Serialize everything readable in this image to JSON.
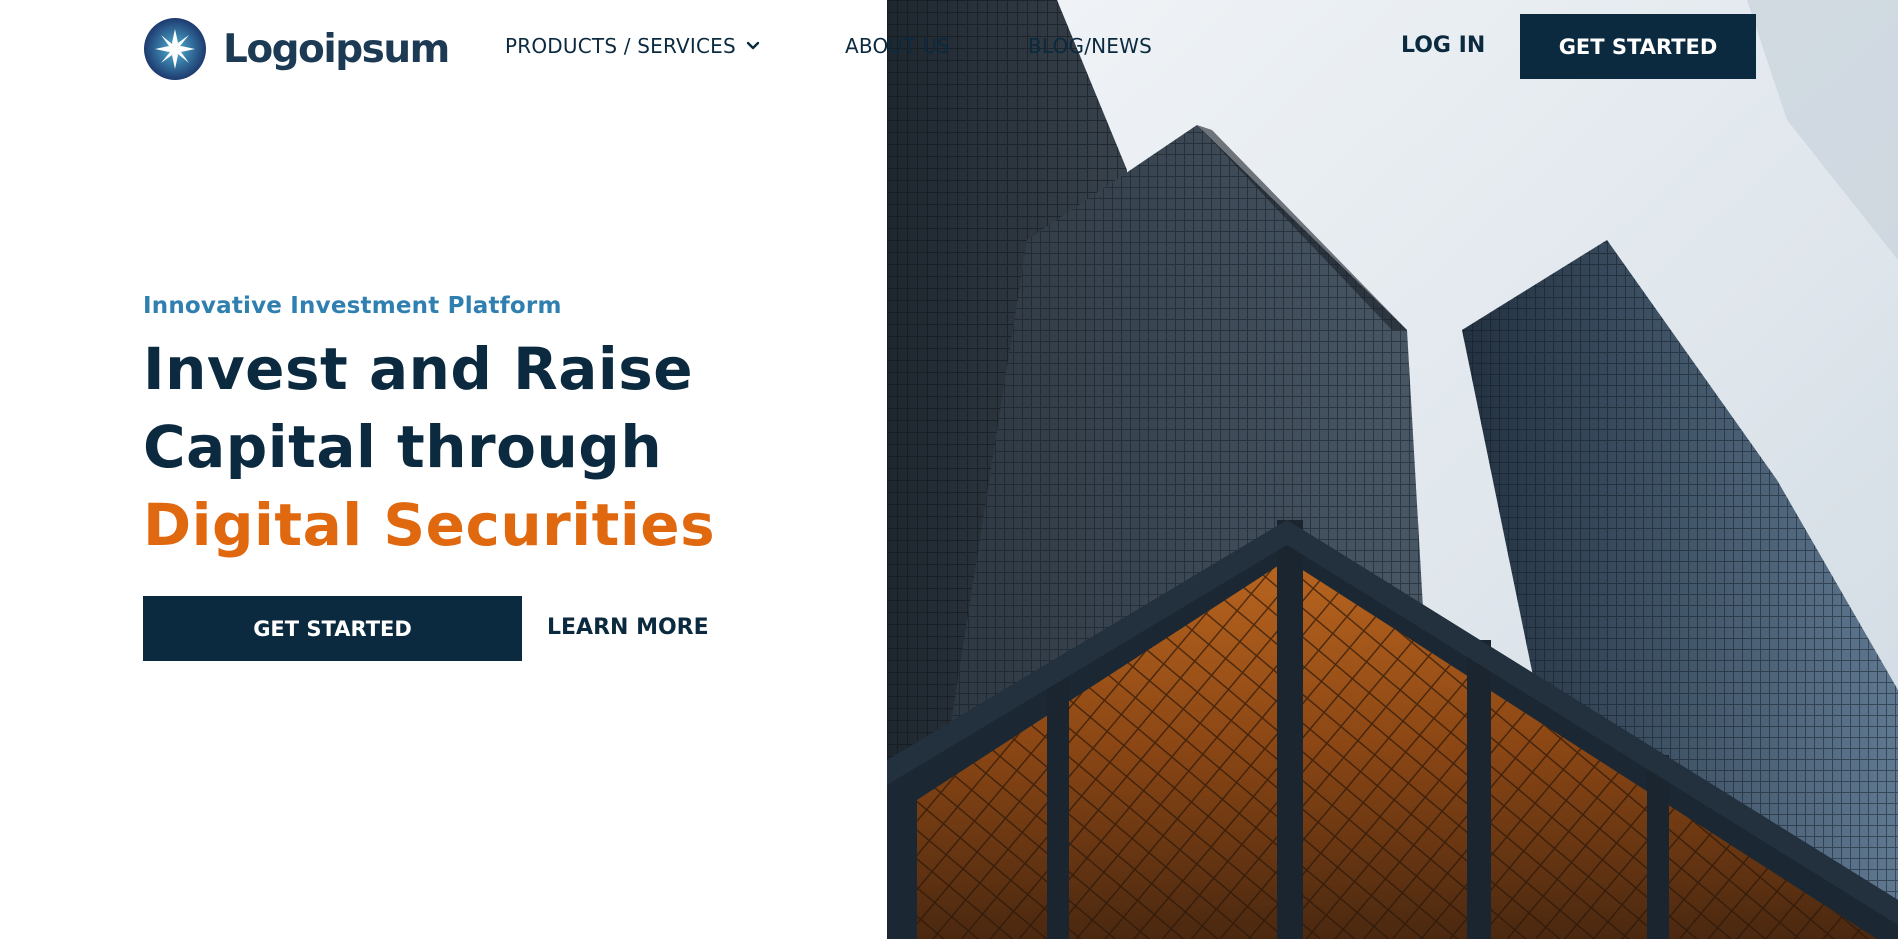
{
  "header": {
    "logo_text": "Logoipsum",
    "nav": {
      "products": "PRODUCTS / SERVICES",
      "about": "ABOUT US",
      "blog": "BLOG/NEWS"
    },
    "login_label": "LOG IN",
    "cta_label": "GET STARTED"
  },
  "hero": {
    "eyebrow": "Innovative Investment Platform",
    "headline_line1": "Invest and Raise",
    "headline_line2": "Capital through",
    "headline_accent": "Digital Securities",
    "primary_cta": "GET STARTED",
    "secondary_cta": "LEARN MORE",
    "image_subject": "skyscrapers-photo"
  },
  "colors": {
    "navy": "#0b2a3f",
    "eyebrow_blue": "#2f7fb0",
    "accent_orange": "#e0680e",
    "background": "#ffffff"
  },
  "icons": [
    "logo-mark-icon",
    "chevron-down-icon"
  ]
}
